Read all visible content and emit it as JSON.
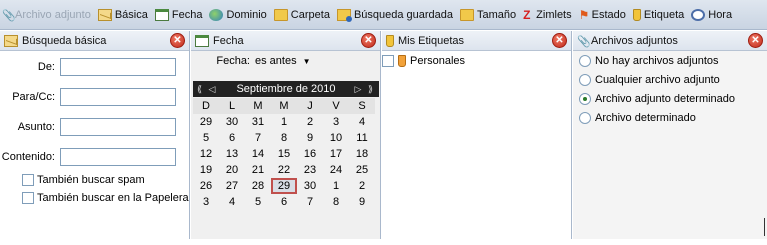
{
  "toolbar": {
    "items": [
      {
        "label": "Archivo adjunto",
        "icon": "attachment-icon",
        "disabled": true
      },
      {
        "label": "Básica",
        "icon": "envelope-icon"
      },
      {
        "label": "Fecha",
        "icon": "calendar-icon"
      },
      {
        "label": "Dominio",
        "icon": "globe-icon"
      },
      {
        "label": "Carpeta",
        "icon": "folder-icon"
      },
      {
        "label": "Búsqueda guardada",
        "icon": "saved-search-icon"
      },
      {
        "label": "Tamaño",
        "icon": "folder-icon"
      },
      {
        "label": "Zimlets",
        "icon": "zimlet-icon"
      },
      {
        "label": "Estado",
        "icon": "flag-icon"
      },
      {
        "label": "Etiqueta",
        "icon": "tag-icon"
      },
      {
        "label": "Hora",
        "icon": "clock-icon"
      }
    ]
  },
  "basic": {
    "title": "Búsqueda básica",
    "fields": {
      "de": {
        "label": "De:",
        "value": ""
      },
      "para": {
        "label": "Para/Cc:",
        "value": ""
      },
      "asunto": {
        "label": "Asunto:",
        "value": ""
      },
      "contenido": {
        "label": "Contenido:",
        "value": ""
      }
    },
    "spam_label": "También buscar spam",
    "trash_label": "También buscar en la Papelera"
  },
  "fecha": {
    "title": "Fecha",
    "label": "Fecha:",
    "selected_option": "es antes",
    "calendar": {
      "month_label": "Septiembre de 2010",
      "nav_prev": "⟪ ◁",
      "nav_next": "▷ ⟫",
      "dow": [
        "D",
        "L",
        "M",
        "M",
        "J",
        "V",
        "S"
      ],
      "weeks": [
        [
          "29",
          "30",
          "31",
          "1",
          "2",
          "3",
          "4"
        ],
        [
          "5",
          "6",
          "7",
          "8",
          "9",
          "10",
          "11"
        ],
        [
          "12",
          "13",
          "14",
          "15",
          "16",
          "17",
          "18"
        ],
        [
          "19",
          "20",
          "21",
          "22",
          "23",
          "24",
          "25"
        ],
        [
          "26",
          "27",
          "28",
          "29",
          "30",
          "1",
          "2"
        ],
        [
          "3",
          "4",
          "5",
          "6",
          "7",
          "8",
          "9"
        ]
      ],
      "selected": {
        "week": 4,
        "day": 3
      }
    }
  },
  "tags": {
    "title": "Mis Etiquetas",
    "items": [
      {
        "label": "Personales"
      }
    ]
  },
  "attachments": {
    "title": "Archivos adjuntos",
    "options": [
      {
        "label": "No hay archivos adjuntos",
        "selected": false
      },
      {
        "label": "Cualquier archivo adjunto",
        "selected": false
      },
      {
        "label": "Archivo adjunto determinado",
        "selected": true
      },
      {
        "label": "Archivo determinado",
        "selected": false
      }
    ]
  },
  "close_glyph": "✕"
}
